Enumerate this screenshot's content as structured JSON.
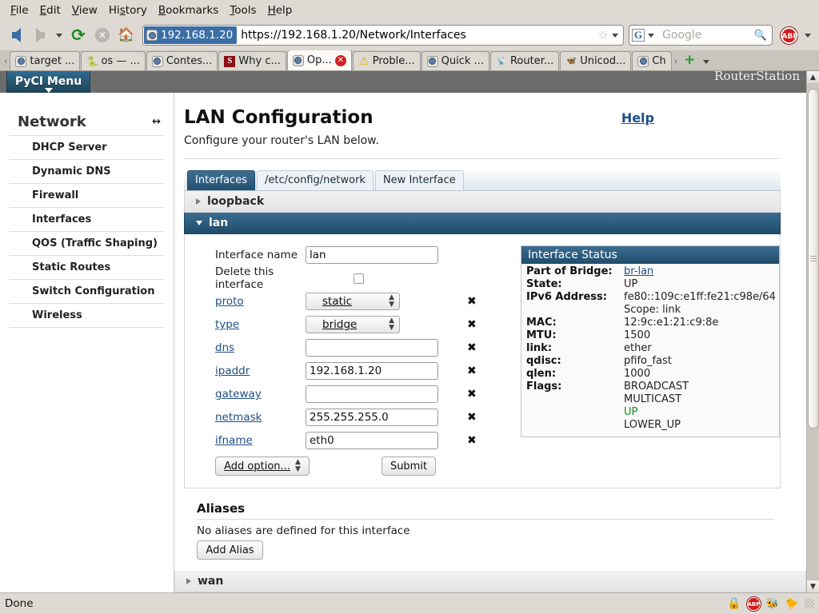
{
  "browser": {
    "menus": [
      "File",
      "Edit",
      "View",
      "History",
      "Bookmarks",
      "Tools",
      "Help"
    ],
    "nav": {
      "back_label": "Back",
      "forward_label": "Forward",
      "reload_label": "Reload",
      "stop_label": "Stop",
      "home_label": "Home"
    },
    "url": {
      "identity": "192.168.1.20",
      "address": "https://192.168.1.20/Network/Interfaces"
    },
    "search": {
      "engine": "G",
      "placeholder": "Google"
    },
    "tabs": [
      {
        "label": "target ...",
        "icon": "globe-icon",
        "active": false,
        "closable": false
      },
      {
        "label": "os — ...",
        "icon": "python-icon",
        "active": false,
        "closable": false
      },
      {
        "label": "Contes...",
        "icon": "globe-icon",
        "active": false,
        "closable": false
      },
      {
        "label": "Why c...",
        "icon": "stackoverflow-icon",
        "active": false,
        "closable": false
      },
      {
        "label": "Op...",
        "icon": "globe-icon",
        "active": true,
        "closable": true
      },
      {
        "label": "Proble...",
        "icon": "warning-icon",
        "active": false,
        "closable": false
      },
      {
        "label": "Quick ...",
        "icon": "globe-icon",
        "active": false,
        "closable": false
      },
      {
        "label": "Router...",
        "icon": "router-icon",
        "active": false,
        "closable": false
      },
      {
        "label": "Unicod...",
        "icon": "unicode-icon",
        "active": false,
        "closable": false
      },
      {
        "label": "Ch",
        "icon": "globe-icon",
        "active": false,
        "closable": false
      }
    ],
    "new_tab_label": "+",
    "status": "Done"
  },
  "app": {
    "menu_button": "PyCI Menu",
    "brand": "RouterStation"
  },
  "sidebar": {
    "title": "Network",
    "resize_icon": "resize-handle-icon",
    "items": [
      {
        "label": "DHCP Server"
      },
      {
        "label": "Dynamic DNS"
      },
      {
        "label": "Firewall"
      },
      {
        "label": "Interfaces"
      },
      {
        "label": "QOS (Traffic Shaping)"
      },
      {
        "label": "Static Routes"
      },
      {
        "label": "Switch Configuration"
      },
      {
        "label": "Wireless"
      }
    ]
  },
  "main": {
    "title": "LAN Configuration",
    "help_label": "Help",
    "subtitle": "Configure your router's LAN below.",
    "tabs": [
      {
        "label": "Interfaces",
        "active": true
      },
      {
        "label": "/etc/config/network",
        "active": false
      },
      {
        "label": "New Interface",
        "active": false
      }
    ],
    "accordion": [
      {
        "label": "loopback",
        "expanded": false
      },
      {
        "label": "lan",
        "expanded": true
      },
      {
        "label": "wan",
        "expanded": false
      }
    ],
    "form": {
      "interface_name_label": "Interface name",
      "interface_name_value": "lan",
      "delete_label": "Delete this interface",
      "delete_checked": false,
      "rows": [
        {
          "label": "proto",
          "type": "select",
          "value": "static",
          "remove": "✖"
        },
        {
          "label": "type",
          "type": "select",
          "value": "bridge",
          "remove": "✖"
        },
        {
          "label": "dns",
          "type": "text",
          "value": "",
          "remove": "✖"
        },
        {
          "label": "ipaddr",
          "type": "text",
          "value": "192.168.1.20",
          "remove": "✖"
        },
        {
          "label": "gateway",
          "type": "text",
          "value": "",
          "remove": "✖"
        },
        {
          "label": "netmask",
          "type": "text",
          "value": "255.255.255.0",
          "remove": "✖"
        },
        {
          "label": "ifname",
          "type": "text",
          "value": "eth0",
          "remove": "✖"
        }
      ],
      "add_option_label": "Add option...",
      "submit_label": "Submit"
    },
    "status_panel": {
      "title": "Interface Status",
      "rows": [
        {
          "key": "Part of Bridge:",
          "value": "br-lan",
          "style": "link"
        },
        {
          "key": "State:",
          "value": "UP",
          "style": "plain"
        },
        {
          "key": "IPv6 Address:",
          "value": "fe80::109c:e1ff:fe21:c98e/64",
          "style": "plain"
        },
        {
          "key": "",
          "value": "Scope: link",
          "style": "plain"
        },
        {
          "key": "MAC:",
          "value": "12:9c:e1:21:c9:8e",
          "style": "plain"
        },
        {
          "key": "MTU:",
          "value": "1500",
          "style": "plain"
        },
        {
          "key": "link:",
          "value": "ether",
          "style": "plain"
        },
        {
          "key": "qdisc:",
          "value": "pfifo_fast",
          "style": "plain"
        },
        {
          "key": "qlen:",
          "value": "1000",
          "style": "plain"
        },
        {
          "key": "Flags:",
          "value": "BROADCAST",
          "style": "plain"
        },
        {
          "key": "",
          "value": "MULTICAST",
          "style": "plain"
        },
        {
          "key": "",
          "value": "UP",
          "style": "green"
        },
        {
          "key": "",
          "value": "LOWER_UP",
          "style": "plain"
        }
      ]
    },
    "aliases": {
      "title": "Aliases",
      "empty_text": "No aliases are defined for this interface",
      "add_label": "Add Alias"
    }
  },
  "colors": {
    "accent_blue": "#1f4c69",
    "header_blue": "#3b6d93",
    "link_blue": "#1d4e86",
    "status_up_green": "#1d8a1d",
    "chrome_gray": "#dedad3",
    "appbar_gray": "#6b6b6b"
  }
}
